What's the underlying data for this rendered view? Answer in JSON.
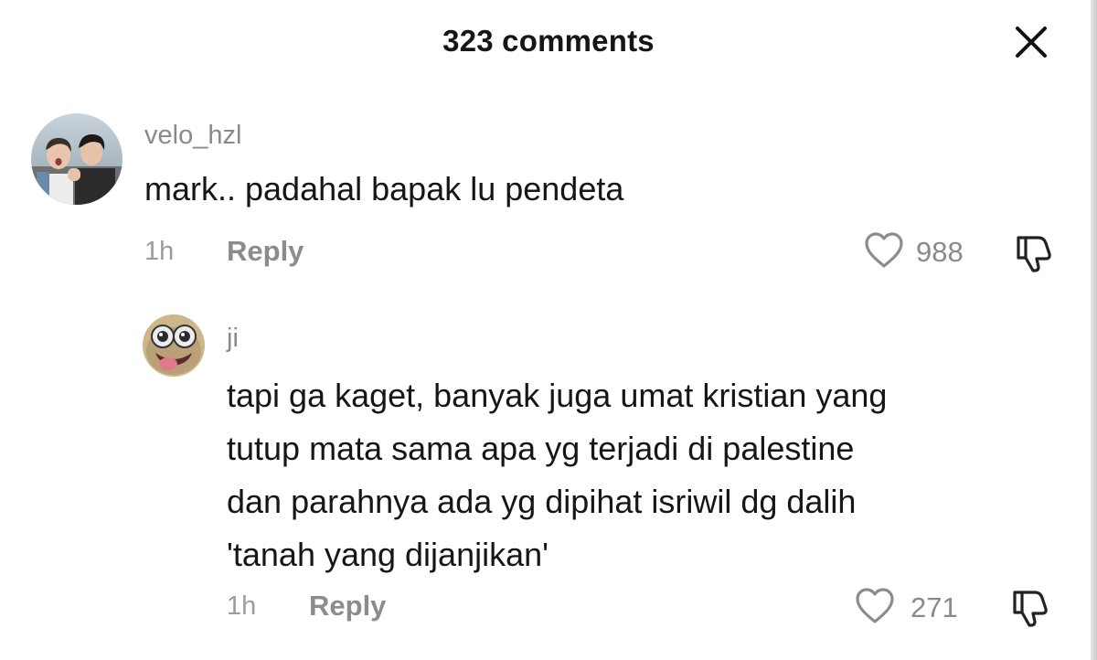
{
  "header": {
    "title": "323 comments",
    "close_icon": "close-icon"
  },
  "comments": [
    {
      "username": "velo_hzl",
      "avatar": "photo-avatar",
      "text_lines": [
        "mark.. padahal bapak lu pendeta"
      ],
      "time": "1h",
      "reply_label": "Reply",
      "like_count": "988"
    },
    {
      "username": "ji",
      "avatar": "cartoon-face-avatar",
      "text_lines": [
        "tapi ga kaget, banyak juga umat kristian yang",
        "tutup mata sama apa yg terjadi di palestine",
        "dan parahnya ada yg dipihat isriwil dg dalih",
        "'tanah yang dijanjikan'"
      ],
      "time": "1h",
      "reply_label": "Reply",
      "like_count": "271"
    }
  ],
  "colors": {
    "text": "#161616",
    "muted": "#8a8a8a",
    "background": "#ffffff"
  }
}
